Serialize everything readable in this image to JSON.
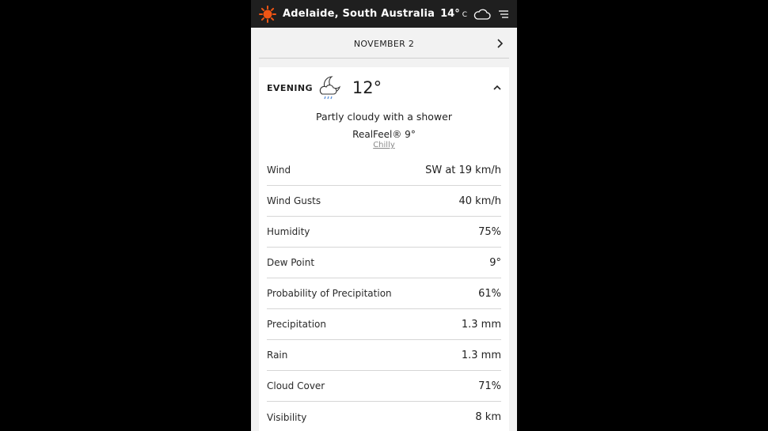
{
  "header": {
    "location": "Adelaide, South Australia",
    "temperature": "14°",
    "unit": "C",
    "logo_icon": "sun-icon",
    "condition_icon": "cloud-icon",
    "menu_icon": "hamburger-menu-icon",
    "brand_color": "#f05514"
  },
  "date_nav": {
    "date": "NOVEMBER 2",
    "next_icon": "chevron-right-icon"
  },
  "forecast": {
    "period": "EVENING",
    "icon": "partly-cloudy-night-shower-icon",
    "temperature": "12°",
    "phrase": "Partly cloudy with a shower",
    "realfeel": "RealFeel® 9°",
    "realfeel_phrase": "Chilly",
    "collapse_icon": "chevron-up-icon"
  },
  "details": [
    {
      "label": "Wind",
      "value": "SW at 19 km/h"
    },
    {
      "label": "Wind Gusts",
      "value": "40 km/h"
    },
    {
      "label": "Humidity",
      "value": "75%"
    },
    {
      "label": "Dew Point",
      "value": "9°"
    },
    {
      "label": "Probability of Precipitation",
      "value": "61%"
    },
    {
      "label": "Precipitation",
      "value": "1.3 mm"
    },
    {
      "label": "Rain",
      "value": "1.3 mm"
    },
    {
      "label": "Cloud Cover",
      "value": "71%"
    },
    {
      "label": "Visibility",
      "value": "8 km"
    }
  ]
}
